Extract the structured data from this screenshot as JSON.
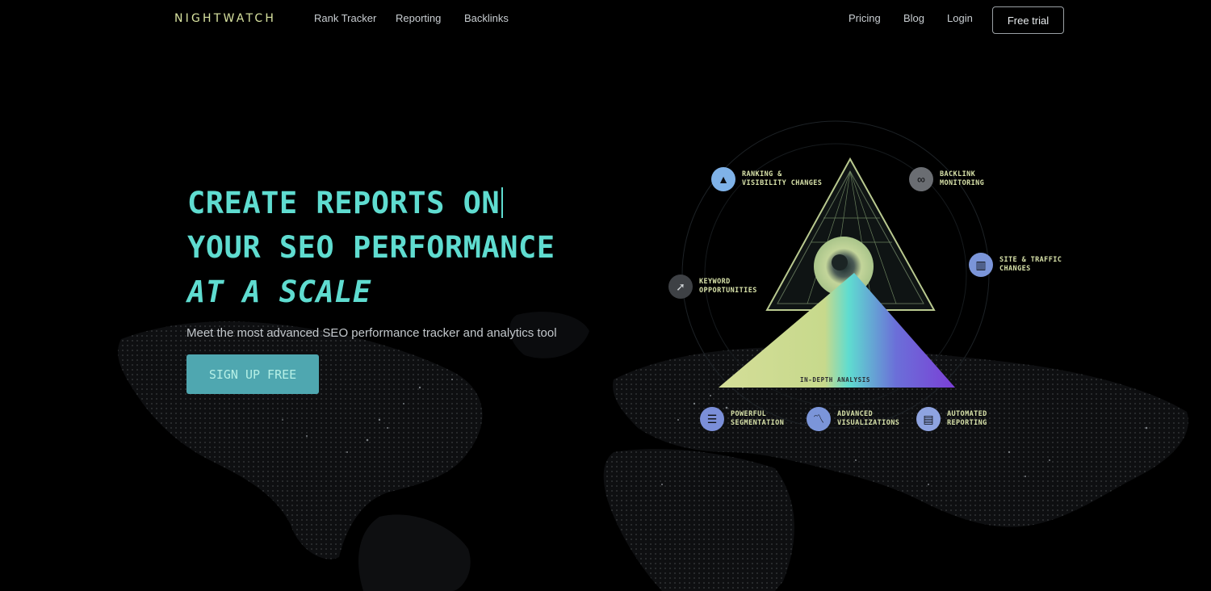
{
  "nav": {
    "logo": "NIGHTWATCH",
    "links": [
      "Rank Tracker",
      "Reporting",
      "Backlinks"
    ],
    "right_links": [
      "Pricing",
      "Blog",
      "Login"
    ],
    "trial_label": "Free trial"
  },
  "hero": {
    "line1": "CREATE REPORTS ON",
    "line2": "YOUR SEO PERFORMANCE",
    "line3": "AT A SCALE",
    "subtitle": "Meet the most advanced SEO performance tracker and analytics tool",
    "cta_label": "SIGN UP FREE"
  },
  "diagram": {
    "features": [
      {
        "label": "RANKING & VISIBILITY CHANGES",
        "icon": "ranking-chart-icon",
        "color": "#7fb2e8"
      },
      {
        "label": "BACKLINK MONITORING",
        "icon": "link-icon",
        "color": "#9a9aa0"
      },
      {
        "label": "SITE & TRAFFIC CHANGES",
        "icon": "bar-chart-icon",
        "color": "#7b95d9"
      },
      {
        "label": "KEYWORD OPPORTUNITIES",
        "icon": "rocket-icon",
        "color": "#9a9aa0"
      },
      {
        "label": "POWERFUL SEGMENTATION",
        "icon": "segments-icon",
        "color": "#7b8fd9"
      },
      {
        "label": "ADVANCED VISUALIZATIONS",
        "icon": "line-chart-icon",
        "color": "#7b95d9"
      },
      {
        "label": "AUTOMATED REPORTING",
        "icon": "document-icon",
        "color": "#8ea3e0"
      }
    ],
    "caption": "IN-DEPTH ANALYSIS"
  },
  "colors": {
    "accent": "#5fdcd0",
    "logo": "#d9e3a0",
    "cta_bg": "#4fa7b0",
    "background": "#000000"
  }
}
